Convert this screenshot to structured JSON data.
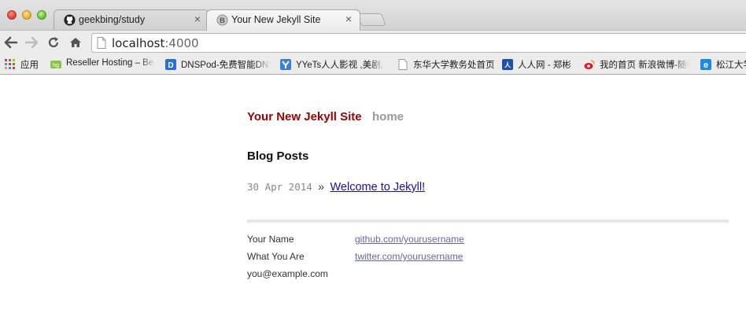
{
  "browser": {
    "tabs": [
      {
        "title": "geekbing/study",
        "icon": "github-icon",
        "active": false
      },
      {
        "title": "Your New Jekyll Site",
        "icon": "blogger-icon",
        "active": true
      }
    ],
    "close_glyph": "×",
    "address": {
      "host": "localhost",
      "port": ":4000"
    },
    "bookmarks": [
      {
        "label": "应用",
        "icon": "apps-grid-icon"
      },
      {
        "label": "Reseller Hosting – Be",
        "icon": "hosting-icon"
      },
      {
        "label": "DNSPod-免费智能DNS",
        "icon": "dnspod-icon"
      },
      {
        "label": "YYeTs人人影视 ,美剧,",
        "icon": "yyets-icon"
      },
      {
        "label": "东华大学教务处首页",
        "icon": "page-icon"
      },
      {
        "label": "人人网 - 郑彬",
        "icon": "renren-icon"
      },
      {
        "label": "我的首页 新浪微博-随时",
        "icon": "weibo-icon"
      },
      {
        "label": "松江大学",
        "icon": "ie-icon"
      }
    ]
  },
  "site": {
    "title": "Your New Jekyll Site",
    "nav_home": "home",
    "posts_heading": "Blog Posts",
    "posts": [
      {
        "date": "30 Apr 2014",
        "separator": "»",
        "title": "Welcome to Jekyll!"
      }
    ],
    "footer": {
      "name": "Your Name",
      "tagline": "What You Are",
      "email": "you@example.com",
      "github": "github.com/yourusername",
      "twitter": "twitter.com/yourusername"
    }
  },
  "colors": {
    "site_title": "#a00000",
    "nav_muted": "#999999",
    "link": "#1c0dad",
    "footer_link": "#6565a8"
  }
}
